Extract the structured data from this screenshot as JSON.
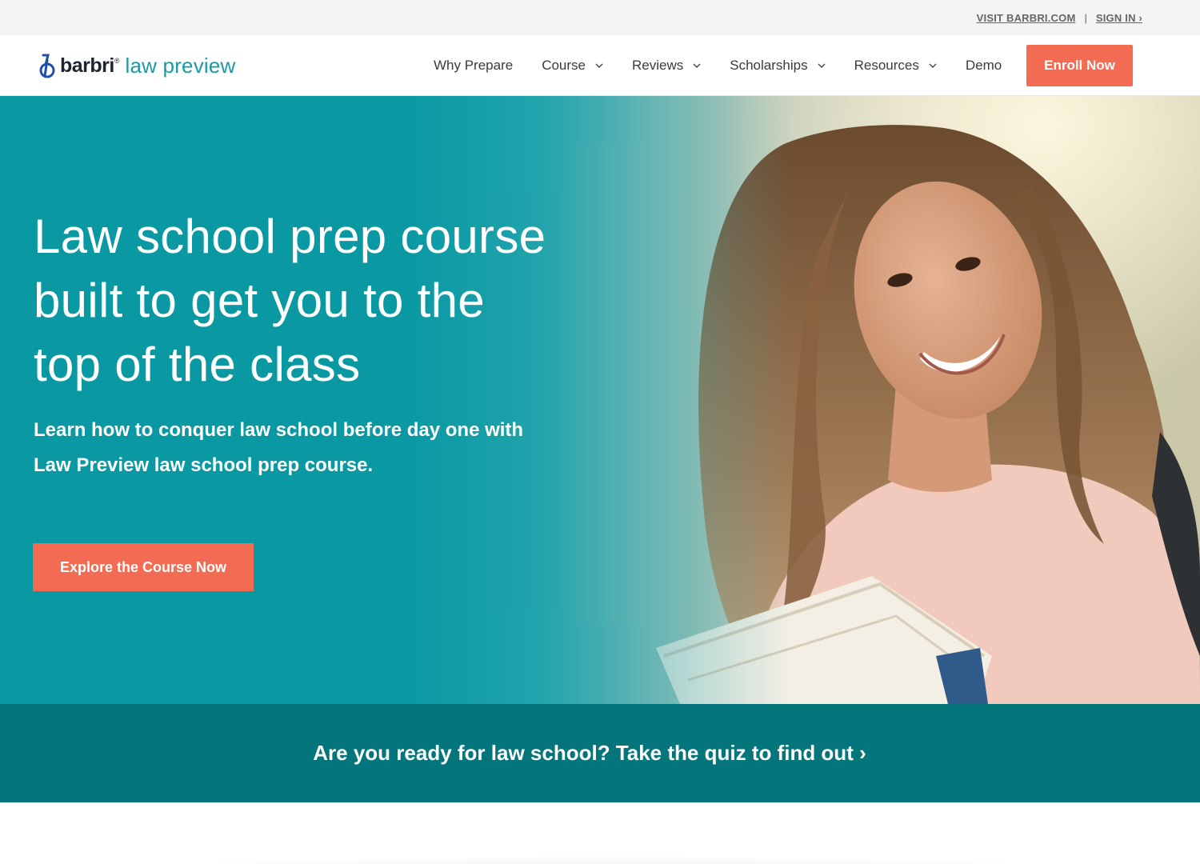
{
  "utility": {
    "visit_label": "VISIT BARBRI.COM",
    "separator": "|",
    "signin_label": "SIGN IN ›"
  },
  "header": {
    "logo_brand": "barbri",
    "logo_trademark": "®",
    "logo_product": "law preview",
    "nav": [
      {
        "label": "Why Prepare",
        "dropdown": false
      },
      {
        "label": "Course",
        "dropdown": true
      },
      {
        "label": "Reviews",
        "dropdown": true
      },
      {
        "label": "Scholarships",
        "dropdown": true
      },
      {
        "label": "Resources",
        "dropdown": true
      },
      {
        "label": "Demo",
        "dropdown": false
      }
    ],
    "enroll_label": "Enroll Now"
  },
  "hero": {
    "title_lines": [
      "Law school prep course",
      "built to get you to the",
      "top of the class"
    ],
    "subtitle_lines": [
      "Learn how to conquer law school before day one with",
      "Law Preview law school prep course."
    ],
    "cta_label": "Explore the Course Now"
  },
  "quiz": {
    "label": "Are you ready for law school? Take the quiz to find out ›"
  },
  "colors": {
    "accent": "#f26b52",
    "teal": "#0a99a3",
    "dark_teal": "#04757b",
    "logo_teal": "#1a9ba4"
  }
}
